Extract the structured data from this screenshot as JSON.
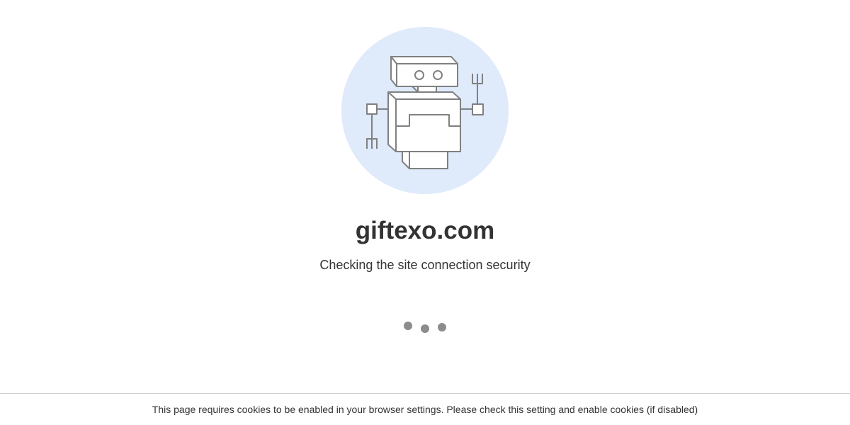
{
  "site": {
    "name": "giftexo.com",
    "status": "Checking the site connection security"
  },
  "footer": {
    "notice": "This page requires cookies to be enabled in your browser settings. Please check this setting and enable cookies (if disabled)"
  },
  "icons": {
    "robot": "robot-icon",
    "loader": "loading-dots-icon"
  },
  "colors": {
    "circle_bg": "#dfeafb",
    "robot_stroke": "#808080",
    "text": "#333333",
    "dot": "#8c8c8c"
  }
}
